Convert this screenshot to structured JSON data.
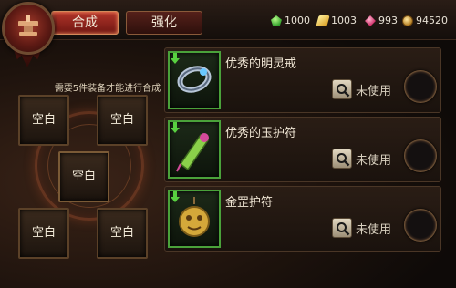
{
  "tabs": [
    {
      "label": "合成",
      "active": true
    },
    {
      "label": "强化",
      "active": false
    }
  ],
  "currencies": [
    {
      "icon": "green-gem-icon",
      "value": "1000"
    },
    {
      "icon": "yellow-crystal-icon",
      "value": "1003"
    },
    {
      "icon": "red-gem-icon",
      "value": "993"
    },
    {
      "icon": "gold-coin-icon",
      "value": "94520"
    }
  ],
  "synthesis": {
    "requirement": "需要5件装备才能进行合成",
    "slots": [
      {
        "label": "空白"
      },
      {
        "label": "空白"
      },
      {
        "label": "空白"
      },
      {
        "label": "空白"
      },
      {
        "label": "空白"
      }
    ]
  },
  "items": [
    {
      "name": "优秀的明灵戒",
      "icon": "ring-icon",
      "status": "未使用"
    },
    {
      "name": "优秀的玉护符",
      "icon": "jade-amulet-icon",
      "status": "未使用"
    },
    {
      "name": "金罡护符",
      "icon": "gold-amulet-icon",
      "status": "未使用"
    }
  ],
  "colors": {
    "active_tab": "#b2352a",
    "item_border": "#4aa23a",
    "background": "#1e130d"
  }
}
